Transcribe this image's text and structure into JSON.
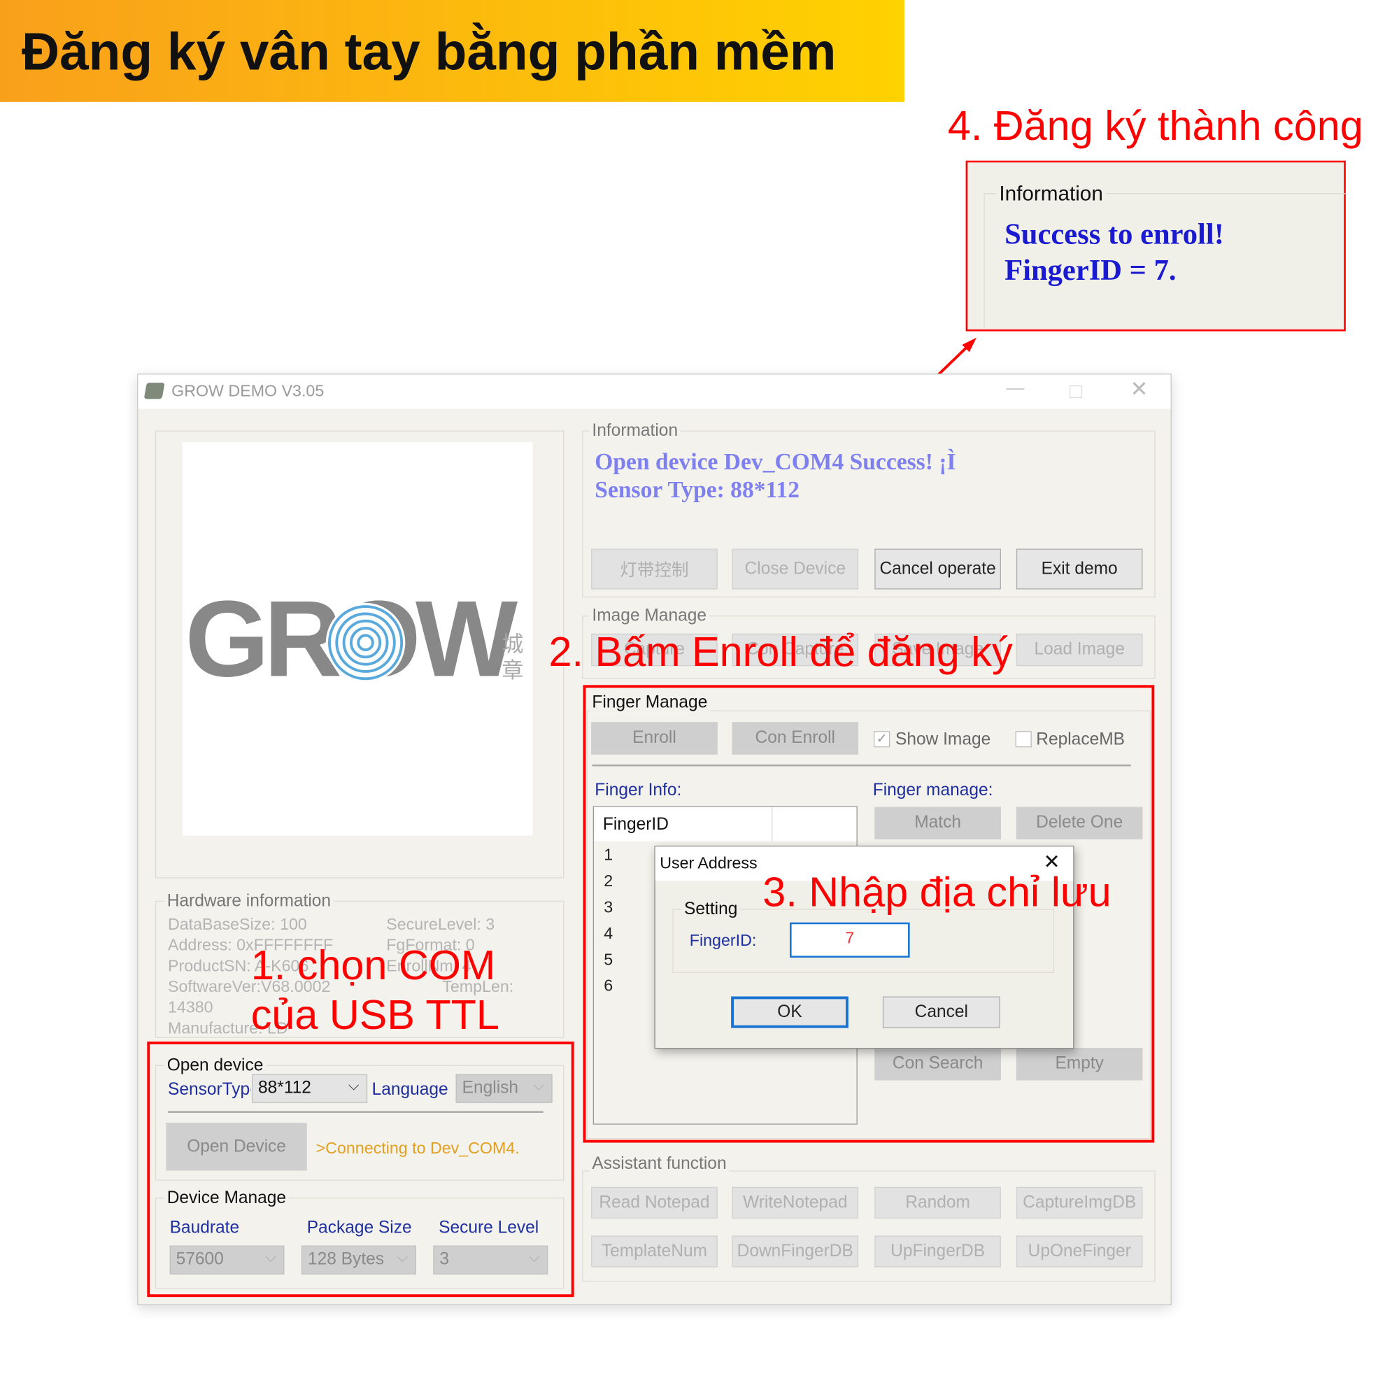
{
  "banner": {
    "title": "Đăng ký vân tay bằng phần mềm",
    "gradient": [
      "#f9a01b",
      "#ffd200"
    ]
  },
  "annotations": {
    "step1_line1": "1. chọn COM",
    "step1_line2": "của USB TTL",
    "step2": "2. Bấm Enroll để đăng ký",
    "step3": "3. Nhập địa chỉ lưu",
    "step4": "4. Đăng ký thành công",
    "color": "#ff0000"
  },
  "success_popup": {
    "group_label": "Information",
    "line1": "Success to enroll!",
    "line2": "FingerID = 7.",
    "text_color": "#1a1ad0"
  },
  "window": {
    "title": "GROW DEMO V3.05",
    "icon": "app-chip-icon",
    "logo_text": "GROW",
    "logo_side_text": "城章"
  },
  "hardware": {
    "label": "Hardware information",
    "left": [
      "DataBaseSize: 100",
      "Address:  0xFFFFFFFF",
      "ProductSN: A-K606",
      "SoftwareVer:V68.0002",
      "14380",
      "Manufacture: LD"
    ],
    "right": [
      "SecureLevel: 3",
      "FgFormat: 0",
      "EnrollNm: 4",
      "TempLen:"
    ]
  },
  "open_device": {
    "label": "Open device",
    "sensor_label": "SensorType",
    "sensor_value": "88*112",
    "language_label": "Language",
    "language_value": "English",
    "open_button": "Open Device",
    "status": ">Connecting to Dev_COM4."
  },
  "device_manage": {
    "label": "Device Manage",
    "fields": [
      {
        "label": "Baudrate",
        "value": "57600"
      },
      {
        "label": "Package Size",
        "value": "128 Bytes"
      },
      {
        "label": "Secure Level",
        "value": "3"
      }
    ]
  },
  "information": {
    "label": "Information",
    "line1": "Open device Dev_COM4 Success! ¡Ì",
    "line2": "Sensor Type: 88*112",
    "buttons": [
      "灯带控制",
      "Close Device",
      "Cancel operate",
      "Exit demo"
    ]
  },
  "image_manage": {
    "label": "Image Manage",
    "buttons": [
      "Capture",
      "Con Capture",
      "Save Image",
      "Load Image"
    ]
  },
  "finger_manage": {
    "label": "Finger Manage",
    "enroll": "Enroll",
    "con_enroll": "Con Enroll",
    "show_image": {
      "label": "Show Image",
      "checked": true
    },
    "replace_mb": {
      "label": "ReplaceMB",
      "checked": false
    },
    "finger_info_label": "Finger Info:",
    "finger_manage_label": "Finger manage:",
    "list_header": "FingerID",
    "list_rows": [
      "1",
      "2",
      "3",
      "4",
      "5",
      "6"
    ],
    "match": "Match",
    "delete_one": "Delete One",
    "con_search": "Con Search",
    "empty": "Empty"
  },
  "dialog": {
    "title": "User Address",
    "group_label": "Setting",
    "field_label": "FingerID:",
    "field_value": "7",
    "ok": "OK",
    "cancel": "Cancel"
  },
  "assistant": {
    "label": "Assistant function",
    "row1": [
      "Read Notepad",
      "WriteNotepad",
      "Random",
      "CaptureImgDB"
    ],
    "row2": [
      "TemplateNum",
      "DownFingerDB",
      "UpFingerDB",
      "UpOneFinger"
    ]
  }
}
